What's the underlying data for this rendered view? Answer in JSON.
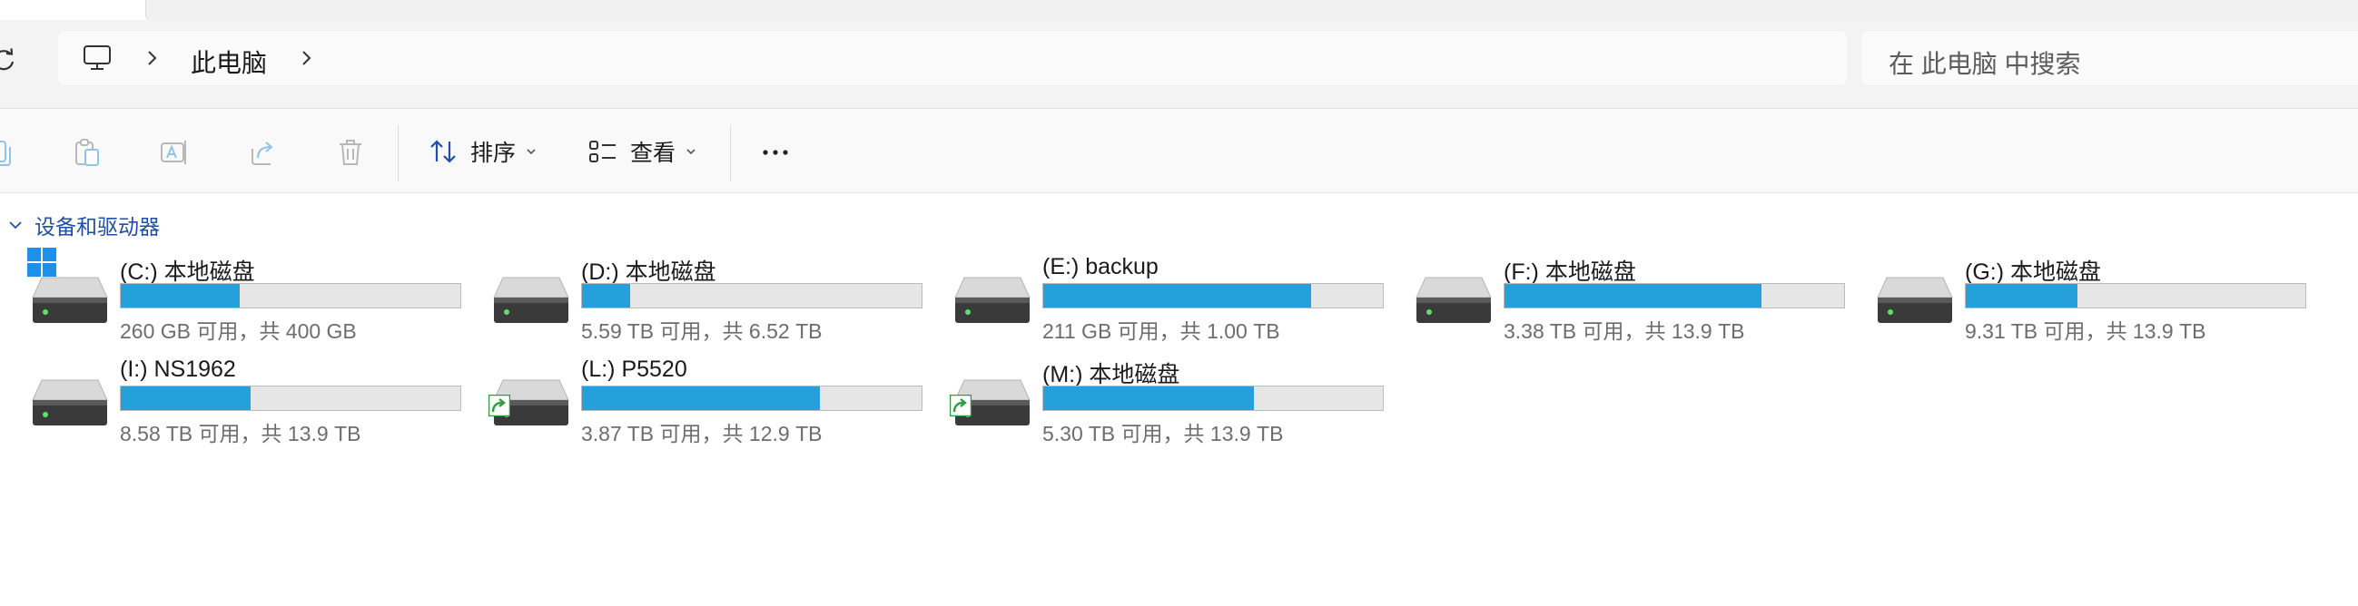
{
  "address": {
    "location_label": "此电脑",
    "search_placeholder": "在 此电脑 中搜索"
  },
  "toolbar": {
    "sort_label": "排序",
    "view_label": "查看"
  },
  "section": {
    "title": "设备和驱动器"
  },
  "drives": [
    {
      "name": "(C:) 本地磁盘",
      "size_text": "260 GB 可用，共 400 GB",
      "used_fraction": 0.35,
      "icon": "windows-drive",
      "shared": false
    },
    {
      "name": "(D:) 本地磁盘",
      "size_text": "5.59 TB 可用，共 6.52 TB",
      "used_fraction": 0.143,
      "icon": "hard-drive",
      "shared": false
    },
    {
      "name": "(E:) backup",
      "size_text": "211 GB 可用，共 1.00 TB",
      "used_fraction": 0.79,
      "icon": "hard-drive",
      "shared": false
    },
    {
      "name": "(F:) 本地磁盘",
      "size_text": "3.38 TB 可用，共 13.9 TB",
      "used_fraction": 0.757,
      "icon": "hard-drive",
      "shared": false
    },
    {
      "name": "(G:) 本地磁盘",
      "size_text": "9.31 TB 可用，共 13.9 TB",
      "used_fraction": 0.33,
      "icon": "hard-drive",
      "shared": false
    },
    {
      "name": "(I:) NS1962",
      "size_text": "8.58 TB 可用，共 13.9 TB",
      "used_fraction": 0.383,
      "icon": "hard-drive",
      "shared": false
    },
    {
      "name": "(L:) P5520",
      "size_text": "3.87 TB 可用，共 12.9 TB",
      "used_fraction": 0.7,
      "icon": "hard-drive",
      "shared": true
    },
    {
      "name": "(M:) 本地磁盘",
      "size_text": "5.30 TB 可用，共 13.9 TB",
      "used_fraction": 0.619,
      "icon": "hard-drive",
      "shared": true
    }
  ],
  "colors": {
    "bar_fill": "#26a0da",
    "bar_track": "#e6e6e6",
    "section_title": "#1f4fa6",
    "share_badge": "#2e9d3b"
  }
}
